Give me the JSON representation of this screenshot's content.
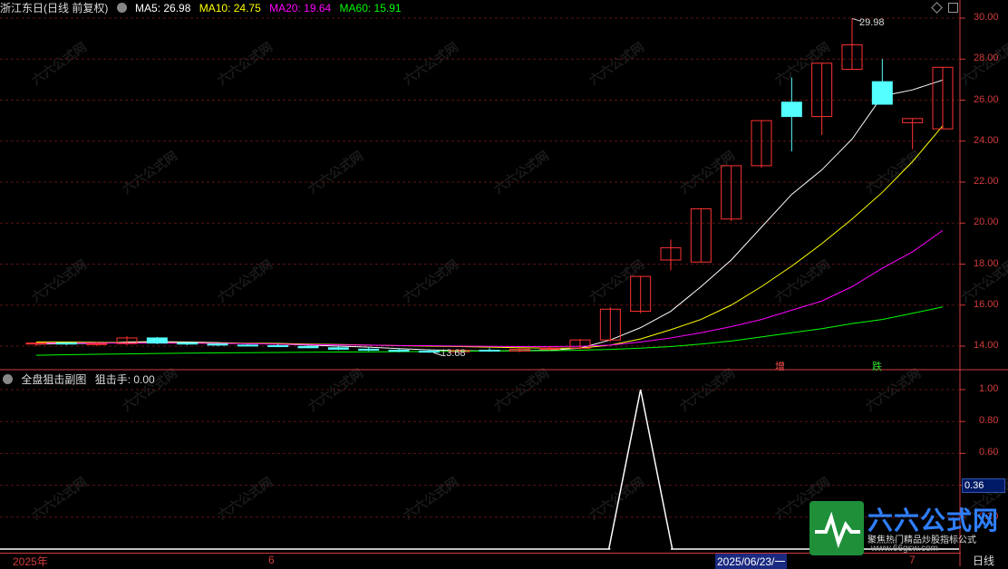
{
  "header": {
    "title": "浙江东日(日线 前复权)",
    "ma5_label": "MA5: 26.98",
    "ma10_label": "MA10: 24.75",
    "ma20_label": "MA20: 19.64",
    "ma60_label": "MA60: 15.91"
  },
  "sub_header": {
    "title": "全盘狙击副图",
    "value_label": "狙击手: 0.00"
  },
  "price_axis": [
    "30.00",
    "28.00",
    "26.00",
    "24.00",
    "22.00",
    "20.00",
    "18.00",
    "16.00",
    "14.00"
  ],
  "indicator_axis": [
    "1.00",
    "0.80",
    "0.60",
    "0.40",
    "0.20"
  ],
  "cursor_value": "0.36",
  "annotations": {
    "high_price": "29.98",
    "low_price": "13.68",
    "marker_up": "增",
    "marker_down": "跌"
  },
  "time_axis": {
    "start": "2025年",
    "month_6": "6",
    "date_cursor": "2025/06/23/一",
    "month_7": "7",
    "period": "日线"
  },
  "logo": {
    "name": "六六公式网",
    "slogan": "聚焦热门精品炒股指标公式",
    "url": "www.66gsw.com"
  },
  "watermark_text": "六六公式网",
  "colors": {
    "up": "#ff3232",
    "down": "#54ffff",
    "ma5": "#ffffff",
    "ma10": "#ffff00",
    "ma20": "#ff00ff",
    "ma60": "#00ff00",
    "axis": "#d23b3b"
  },
  "chart_data": [
    {
      "type": "candlestick",
      "title": "浙江东日(日线 前复权)",
      "ylim": [
        13,
        30.5
      ],
      "candles": [
        {
          "o": 14.1,
          "h": 14.2,
          "l": 14.0,
          "c": 14.15
        },
        {
          "o": 14.15,
          "h": 14.2,
          "l": 14.05,
          "c": 14.1
        },
        {
          "o": 14.1,
          "h": 14.2,
          "l": 14.0,
          "c": 14.12
        },
        {
          "o": 14.12,
          "h": 14.5,
          "l": 14.05,
          "c": 14.4
        },
        {
          "o": 14.4,
          "h": 14.45,
          "l": 14.1,
          "c": 14.15
        },
        {
          "o": 14.15,
          "h": 14.2,
          "l": 14.05,
          "c": 14.1
        },
        {
          "o": 14.1,
          "h": 14.15,
          "l": 14.0,
          "c": 14.05
        },
        {
          "o": 14.05,
          "h": 14.1,
          "l": 14.0,
          "c": 14.02
        },
        {
          "o": 14.02,
          "h": 14.1,
          "l": 13.95,
          "c": 13.98
        },
        {
          "o": 13.98,
          "h": 14.05,
          "l": 13.9,
          "c": 13.92
        },
        {
          "o": 13.92,
          "h": 14.0,
          "l": 13.8,
          "c": 13.85
        },
        {
          "o": 13.85,
          "h": 13.95,
          "l": 13.75,
          "c": 13.8
        },
        {
          "o": 13.8,
          "h": 13.9,
          "l": 13.7,
          "c": 13.75
        },
        {
          "o": 13.75,
          "h": 13.85,
          "l": 13.68,
          "c": 13.72
        },
        {
          "o": 13.72,
          "h": 13.85,
          "l": 13.7,
          "c": 13.8
        },
        {
          "o": 13.8,
          "h": 13.9,
          "l": 13.72,
          "c": 13.76
        },
        {
          "o": 13.76,
          "h": 13.9,
          "l": 13.7,
          "c": 13.85
        },
        {
          "o": 13.85,
          "h": 14.0,
          "l": 13.8,
          "c": 13.9
        },
        {
          "o": 13.9,
          "h": 14.35,
          "l": 13.85,
          "c": 14.3
        },
        {
          "o": 14.3,
          "h": 15.9,
          "l": 14.2,
          "c": 15.8
        },
        {
          "o": 15.7,
          "h": 17.4,
          "l": 15.6,
          "c": 17.4
        },
        {
          "o": 18.2,
          "h": 19.2,
          "l": 17.7,
          "c": 18.8
        },
        {
          "o": 18.1,
          "h": 20.7,
          "l": 18.1,
          "c": 20.7
        },
        {
          "o": 20.2,
          "h": 22.8,
          "l": 20.1,
          "c": 22.8
        },
        {
          "o": 22.8,
          "h": 25.0,
          "l": 22.7,
          "c": 25.0
        },
        {
          "o": 25.9,
          "h": 27.1,
          "l": 23.5,
          "c": 25.2
        },
        {
          "o": 25.2,
          "h": 27.8,
          "l": 24.3,
          "c": 27.8
        },
        {
          "o": 27.5,
          "h": 29.98,
          "l": 27.5,
          "c": 28.7
        },
        {
          "o": 26.9,
          "h": 28.0,
          "l": 25.8,
          "c": 25.8
        },
        {
          "o": 24.9,
          "h": 25.1,
          "l": 23.6,
          "c": 25.1
        },
        {
          "o": 24.6,
          "h": 27.6,
          "l": 24.6,
          "c": 27.6
        }
      ],
      "ma_series": [
        {
          "name": "MA5",
          "values": [
            14.1,
            14.12,
            14.13,
            14.2,
            14.22,
            14.2,
            14.17,
            14.12,
            14.1,
            14.05,
            14.0,
            13.95,
            13.88,
            13.82,
            13.78,
            13.76,
            13.78,
            13.8,
            13.9,
            14.3,
            14.9,
            15.7,
            16.9,
            18.2,
            19.8,
            21.4,
            22.6,
            24.1,
            26.2,
            26.5,
            26.98
          ]
        },
        {
          "name": "MA10",
          "values": [
            14.2,
            14.2,
            14.18,
            14.17,
            14.17,
            14.16,
            14.15,
            14.14,
            14.13,
            14.1,
            14.08,
            14.05,
            14.02,
            14.0,
            13.98,
            13.95,
            13.92,
            13.9,
            13.9,
            14.05,
            14.35,
            14.8,
            15.3,
            16.0,
            16.9,
            17.9,
            19.0,
            20.2,
            21.5,
            23.0,
            24.75
          ]
        },
        {
          "name": "MA20",
          "values": [
            14.15,
            14.15,
            14.15,
            14.15,
            14.15,
            14.14,
            14.13,
            14.12,
            14.1,
            14.08,
            14.06,
            14.05,
            14.03,
            14.02,
            14.0,
            13.99,
            13.98,
            13.98,
            13.99,
            14.05,
            14.2,
            14.4,
            14.65,
            14.95,
            15.3,
            15.75,
            16.2,
            16.9,
            17.8,
            18.6,
            19.64
          ]
        },
        {
          "name": "MA60",
          "values": [
            13.55,
            13.58,
            13.6,
            13.62,
            13.64,
            13.66,
            13.67,
            13.68,
            13.69,
            13.7,
            13.71,
            13.72,
            13.73,
            13.74,
            13.75,
            13.76,
            13.77,
            13.78,
            13.8,
            13.84,
            13.9,
            13.98,
            14.1,
            14.25,
            14.45,
            14.65,
            14.85,
            15.1,
            15.3,
            15.6,
            15.91
          ]
        }
      ]
    },
    {
      "type": "line",
      "title": "全盘狙击副图",
      "ylim": [
        0,
        1.05
      ],
      "series": [
        {
          "name": "狙击手",
          "values": [
            0,
            0,
            0,
            0,
            0,
            0,
            0,
            0,
            0,
            0,
            0,
            0,
            0,
            0,
            0,
            0,
            0,
            0,
            0,
            0,
            1,
            0,
            0,
            0,
            0,
            0,
            0,
            0,
            0,
            0,
            0
          ]
        }
      ]
    }
  ]
}
